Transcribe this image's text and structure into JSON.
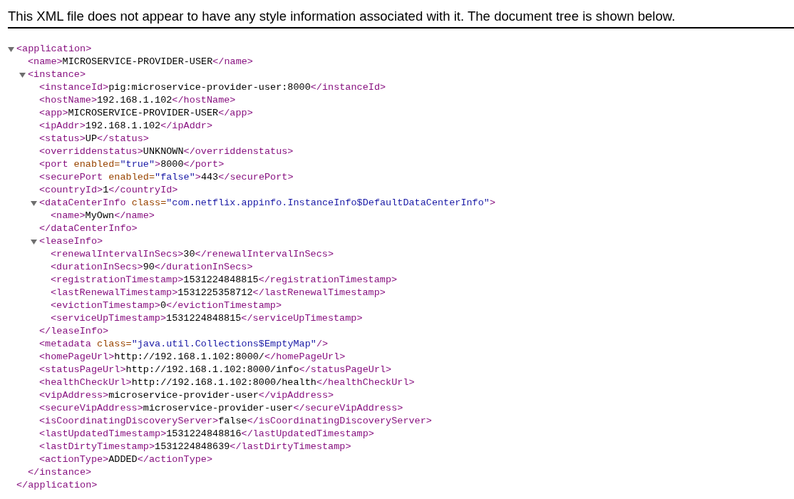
{
  "notice": "This XML file does not appear to have any style information associated with it. The document tree is shown below.",
  "tree": [
    {
      "expanded": true,
      "open": [
        {
          "kind": "tag",
          "text": "<application>"
        }
      ],
      "close": [
        {
          "kind": "tag",
          "text": "</application>"
        }
      ],
      "children": [
        {
          "line": [
            {
              "kind": "tag",
              "text": "<name>"
            },
            {
              "kind": "text",
              "text": "MICROSERVICE-PROVIDER-USER"
            },
            {
              "kind": "tag",
              "text": "</name>"
            }
          ]
        },
        {
          "expanded": true,
          "open": [
            {
              "kind": "tag",
              "text": "<instance>"
            }
          ],
          "close": [
            {
              "kind": "tag",
              "text": "</instance>"
            }
          ],
          "children": [
            {
              "line": [
                {
                  "kind": "tag",
                  "text": "<instanceId>"
                },
                {
                  "kind": "text",
                  "text": "pig:microservice-provider-user:8000"
                },
                {
                  "kind": "tag",
                  "text": "</instanceId>"
                }
              ]
            },
            {
              "line": [
                {
                  "kind": "tag",
                  "text": "<hostName>"
                },
                {
                  "kind": "text",
                  "text": "192.168.1.102"
                },
                {
                  "kind": "tag",
                  "text": "</hostName>"
                }
              ]
            },
            {
              "line": [
                {
                  "kind": "tag",
                  "text": "<app>"
                },
                {
                  "kind": "text",
                  "text": "MICROSERVICE-PROVIDER-USER"
                },
                {
                  "kind": "tag",
                  "text": "</app>"
                }
              ]
            },
            {
              "line": [
                {
                  "kind": "tag",
                  "text": "<ipAddr>"
                },
                {
                  "kind": "text",
                  "text": "192.168.1.102"
                },
                {
                  "kind": "tag",
                  "text": "</ipAddr>"
                }
              ]
            },
            {
              "line": [
                {
                  "kind": "tag",
                  "text": "<status>"
                },
                {
                  "kind": "text",
                  "text": "UP"
                },
                {
                  "kind": "tag",
                  "text": "</status>"
                }
              ]
            },
            {
              "line": [
                {
                  "kind": "tag",
                  "text": "<overriddenstatus>"
                },
                {
                  "kind": "text",
                  "text": "UNKNOWN"
                },
                {
                  "kind": "tag",
                  "text": "</overriddenstatus>"
                }
              ]
            },
            {
              "line": [
                {
                  "kind": "tag",
                  "text": "<port"
                },
                {
                  "kind": "attr",
                  "text": " enabled="
                },
                {
                  "kind": "value",
                  "text": "\"true\""
                },
                {
                  "kind": "tag",
                  "text": ">"
                },
                {
                  "kind": "text",
                  "text": "8000"
                },
                {
                  "kind": "tag",
                  "text": "</port>"
                }
              ]
            },
            {
              "line": [
                {
                  "kind": "tag",
                  "text": "<securePort"
                },
                {
                  "kind": "attr",
                  "text": " enabled="
                },
                {
                  "kind": "value",
                  "text": "\"false\""
                },
                {
                  "kind": "tag",
                  "text": ">"
                },
                {
                  "kind": "text",
                  "text": "443"
                },
                {
                  "kind": "tag",
                  "text": "</securePort>"
                }
              ]
            },
            {
              "line": [
                {
                  "kind": "tag",
                  "text": "<countryId>"
                },
                {
                  "kind": "text",
                  "text": "1"
                },
                {
                  "kind": "tag",
                  "text": "</countryId>"
                }
              ]
            },
            {
              "expanded": true,
              "open": [
                {
                  "kind": "tag",
                  "text": "<dataCenterInfo"
                },
                {
                  "kind": "attr",
                  "text": " class="
                },
                {
                  "kind": "value",
                  "text": "\"com.netflix.appinfo.InstanceInfo$DefaultDataCenterInfo\""
                },
                {
                  "kind": "tag",
                  "text": ">"
                }
              ],
              "close": [
                {
                  "kind": "tag",
                  "text": "</dataCenterInfo>"
                }
              ],
              "children": [
                {
                  "line": [
                    {
                      "kind": "tag",
                      "text": "<name>"
                    },
                    {
                      "kind": "text",
                      "text": "MyOwn"
                    },
                    {
                      "kind": "tag",
                      "text": "</name>"
                    }
                  ]
                }
              ]
            },
            {
              "expanded": true,
              "open": [
                {
                  "kind": "tag",
                  "text": "<leaseInfo>"
                }
              ],
              "close": [
                {
                  "kind": "tag",
                  "text": "</leaseInfo>"
                }
              ],
              "children": [
                {
                  "line": [
                    {
                      "kind": "tag",
                      "text": "<renewalIntervalInSecs>"
                    },
                    {
                      "kind": "text",
                      "text": "30"
                    },
                    {
                      "kind": "tag",
                      "text": "</renewalIntervalInSecs>"
                    }
                  ]
                },
                {
                  "line": [
                    {
                      "kind": "tag",
                      "text": "<durationInSecs>"
                    },
                    {
                      "kind": "text",
                      "text": "90"
                    },
                    {
                      "kind": "tag",
                      "text": "</durationInSecs>"
                    }
                  ]
                },
                {
                  "line": [
                    {
                      "kind": "tag",
                      "text": "<registrationTimestamp>"
                    },
                    {
                      "kind": "text",
                      "text": "1531224848815"
                    },
                    {
                      "kind": "tag",
                      "text": "</registrationTimestamp>"
                    }
                  ]
                },
                {
                  "line": [
                    {
                      "kind": "tag",
                      "text": "<lastRenewalTimestamp>"
                    },
                    {
                      "kind": "text",
                      "text": "1531225358712"
                    },
                    {
                      "kind": "tag",
                      "text": "</lastRenewalTimestamp>"
                    }
                  ]
                },
                {
                  "line": [
                    {
                      "kind": "tag",
                      "text": "<evictionTimestamp>"
                    },
                    {
                      "kind": "text",
                      "text": "0"
                    },
                    {
                      "kind": "tag",
                      "text": "</evictionTimestamp>"
                    }
                  ]
                },
                {
                  "line": [
                    {
                      "kind": "tag",
                      "text": "<serviceUpTimestamp>"
                    },
                    {
                      "kind": "text",
                      "text": "1531224848815"
                    },
                    {
                      "kind": "tag",
                      "text": "</serviceUpTimestamp>"
                    }
                  ]
                }
              ]
            },
            {
              "line": [
                {
                  "kind": "tag",
                  "text": "<metadata"
                },
                {
                  "kind": "attr",
                  "text": " class="
                },
                {
                  "kind": "value",
                  "text": "\"java.util.Collections$EmptyMap\""
                },
                {
                  "kind": "tag",
                  "text": "/>"
                }
              ]
            },
            {
              "line": [
                {
                  "kind": "tag",
                  "text": "<homePageUrl>"
                },
                {
                  "kind": "text",
                  "text": "http://192.168.1.102:8000/"
                },
                {
                  "kind": "tag",
                  "text": "</homePageUrl>"
                }
              ]
            },
            {
              "line": [
                {
                  "kind": "tag",
                  "text": "<statusPageUrl>"
                },
                {
                  "kind": "text",
                  "text": "http://192.168.1.102:8000/info"
                },
                {
                  "kind": "tag",
                  "text": "</statusPageUrl>"
                }
              ]
            },
            {
              "line": [
                {
                  "kind": "tag",
                  "text": "<healthCheckUrl>"
                },
                {
                  "kind": "text",
                  "text": "http://192.168.1.102:8000/health"
                },
                {
                  "kind": "tag",
                  "text": "</healthCheckUrl>"
                }
              ]
            },
            {
              "line": [
                {
                  "kind": "tag",
                  "text": "<vipAddress>"
                },
                {
                  "kind": "text",
                  "text": "microservice-provider-user"
                },
                {
                  "kind": "tag",
                  "text": "</vipAddress>"
                }
              ]
            },
            {
              "line": [
                {
                  "kind": "tag",
                  "text": "<secureVipAddress>"
                },
                {
                  "kind": "text",
                  "text": "microservice-provider-user"
                },
                {
                  "kind": "tag",
                  "text": "</secureVipAddress>"
                }
              ]
            },
            {
              "line": [
                {
                  "kind": "tag",
                  "text": "<isCoordinatingDiscoveryServer>"
                },
                {
                  "kind": "text",
                  "text": "false"
                },
                {
                  "kind": "tag",
                  "text": "</isCoordinatingDiscoveryServer>"
                }
              ]
            },
            {
              "line": [
                {
                  "kind": "tag",
                  "text": "<lastUpdatedTimestamp>"
                },
                {
                  "kind": "text",
                  "text": "1531224848816"
                },
                {
                  "kind": "tag",
                  "text": "</lastUpdatedTimestamp>"
                }
              ]
            },
            {
              "line": [
                {
                  "kind": "tag",
                  "text": "<lastDirtyTimestamp>"
                },
                {
                  "kind": "text",
                  "text": "1531224848639"
                },
                {
                  "kind": "tag",
                  "text": "</lastDirtyTimestamp>"
                }
              ]
            },
            {
              "line": [
                {
                  "kind": "tag",
                  "text": "<actionType>"
                },
                {
                  "kind": "text",
                  "text": "ADDED"
                },
                {
                  "kind": "tag",
                  "text": "</actionType>"
                }
              ]
            }
          ]
        }
      ]
    }
  ]
}
